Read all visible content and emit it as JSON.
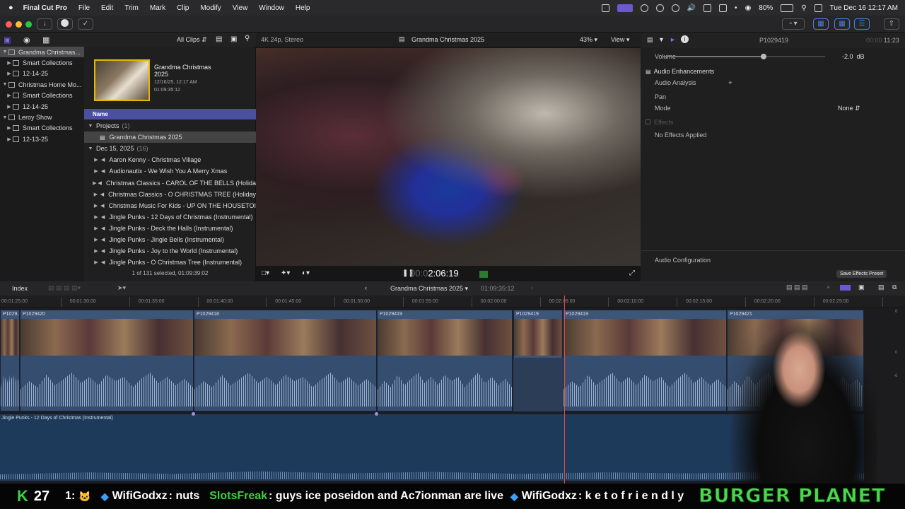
{
  "menubar": {
    "app_name": "Final Cut Pro",
    "items": [
      "File",
      "Edit",
      "Trim",
      "Mark",
      "Clip",
      "Modify",
      "View",
      "Window",
      "Help"
    ],
    "battery": "80%",
    "clock": "Tue Dec 16  12:17 AM"
  },
  "browser": {
    "filter": "All Clips",
    "libraries": [
      {
        "label": "Grandma Christmas...",
        "level": 0,
        "selected": true
      },
      {
        "label": "Smart Collections",
        "level": 1
      },
      {
        "label": "12-14-25",
        "level": 1
      },
      {
        "label": "Christmas Home Mo...",
        "level": 0
      },
      {
        "label": "Smart Collections",
        "level": 1
      },
      {
        "label": "12-14-25",
        "level": 1
      },
      {
        "label": "Leroy Show",
        "level": 0
      },
      {
        "label": "Smart Collections",
        "level": 1
      },
      {
        "label": "12-13-25",
        "level": 1
      }
    ],
    "project_card": {
      "title": "Grandma Christmas 2025",
      "date": "12/16/25, 12:17 AM",
      "duration": "01:09:35:12"
    },
    "name_header": "Name",
    "projects_group": {
      "label": "Projects",
      "count": "(1)"
    },
    "project_item": "Grandma Christmas 2025",
    "date_group": {
      "label": "Dec 15, 2025",
      "count": "(16)"
    },
    "clips": [
      "Aaron Kenny - Christmas Village",
      "Audionautix - We Wish You A Merry Xmas",
      "Christmas Classics - CAROL OF THE BELLS (Holida",
      "Christmas Classics - O CHRISTMAS TREE (Holiday",
      "Christmas Music For Kids - UP ON THE HOUSETOI",
      "Jingle Punks - 12 Days of Christmas (Instrumental)",
      "Jingle Punks - Deck the Halls (Instrumental)",
      "Jingle Punks - Jingle Bells (Instrumental)",
      "Jingle Punks - Joy to the World (Instrumental)",
      "Jingle Punks - O Christmas Tree (Instrumental)"
    ],
    "status": "1 of 131 selected, 01:09:39:02"
  },
  "viewer": {
    "format": "4K 24p, Stereo",
    "title": "Grandma Christmas 2025",
    "zoom": "43%",
    "view_label": "View",
    "timecode_dim": "00:0",
    "timecode": "2:06:19"
  },
  "inspector": {
    "clip_name": "P1029419",
    "duration_dim": "00:00",
    "duration": "11:23",
    "volume_label": "Volume",
    "volume_value": "-2.0",
    "volume_unit": "dB",
    "volume_level": 0.62,
    "enhancements": "Audio Enhancements",
    "analysis": "Audio Analysis",
    "pan": "Pan",
    "mode": "Mode",
    "mode_value": "None",
    "effects": "Effects",
    "no_effects": "No Effects Applied",
    "config": "Audio Configuration",
    "save_preset": "Save Effects Preset"
  },
  "timeline_bar": {
    "index": "Index",
    "project": "Grandma Christmas 2025",
    "timecode": "01:09:35:12"
  },
  "ruler_ticks": [
    "00:01:25:00",
    "00:01:30:00",
    "00:01:35:00",
    "00:01:40:00",
    "00:01:45:00",
    "00:01:50:00",
    "00:01:55:00",
    "00:02:00:00",
    "00:02:05:00",
    "00:02:10:00",
    "00:02:15:00",
    "00:02:20:00",
    "00:02:25:00"
  ],
  "clips": [
    {
      "label": "P1029..."
    },
    {
      "label": "P1029420"
    },
    {
      "label": "P1029418"
    },
    {
      "label": "P1029419"
    },
    {
      "label": "P1029419"
    },
    {
      "label": "P1029419"
    },
    {
      "label": "P1029421"
    }
  ],
  "music_clip": "Jingle Punks - 12 Days of Christmas (Instrumental)",
  "meter_labels": [
    "6",
    "0",
    "-6"
  ],
  "chat": {
    "counter_letter": "K",
    "counter": "27",
    "prefix": "1:",
    "messages": [
      {
        "user": "WifiGodxz",
        "text": ": nuts"
      },
      {
        "user": "SlotsFreak",
        "text": ": guys ice poseidon and Ac7ionman are live"
      },
      {
        "user": "WifiGodxz",
        "text": ": k e t o f r i e n d l y"
      }
    ],
    "banner": "BURGER PLANET"
  }
}
